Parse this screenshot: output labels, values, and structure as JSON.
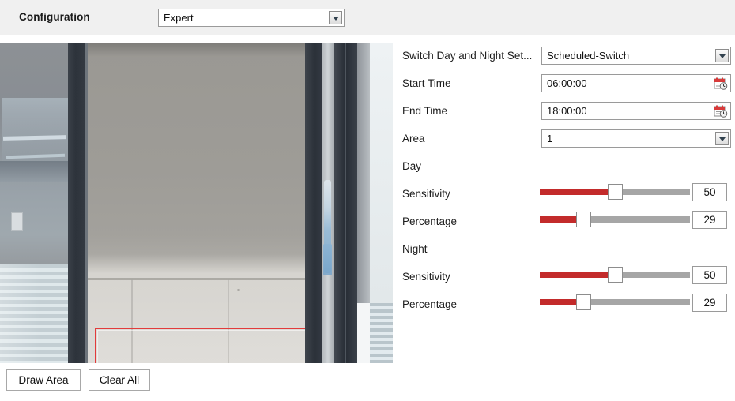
{
  "header": {
    "label": "Configuration",
    "mode_value": "Expert",
    "dropdown_icon": "chevron-down-icon"
  },
  "video": {
    "detection_area_icon": "detection-region-rect",
    "draw_button": "Draw Area",
    "clear_button": "Clear All"
  },
  "settings": {
    "switch_mode": {
      "label": "Switch Day and Night Set...",
      "value": "Scheduled-Switch"
    },
    "start_time": {
      "label": "Start Time",
      "value": "06:00:00",
      "icon": "calendar-clock-icon"
    },
    "end_time": {
      "label": "End Time",
      "value": "18:00:00",
      "icon": "calendar-clock-icon"
    },
    "area": {
      "label": "Area",
      "value": "1"
    },
    "day": {
      "section": "Day",
      "sensitivity": {
        "label": "Sensitivity",
        "value": "50",
        "percent": 50
      },
      "percentage": {
        "label": "Percentage",
        "value": "29",
        "percent": 29
      }
    },
    "night": {
      "section": "Night",
      "sensitivity": {
        "label": "Sensitivity",
        "value": "50",
        "percent": 50
      },
      "percentage": {
        "label": "Percentage",
        "value": "29",
        "percent": 29
      }
    }
  },
  "colors": {
    "slider_fill": "#c32b2b",
    "slider_track": "#a6a6a6",
    "detect_rect": "#e23b3b",
    "header_bg": "#f0f0f0"
  }
}
